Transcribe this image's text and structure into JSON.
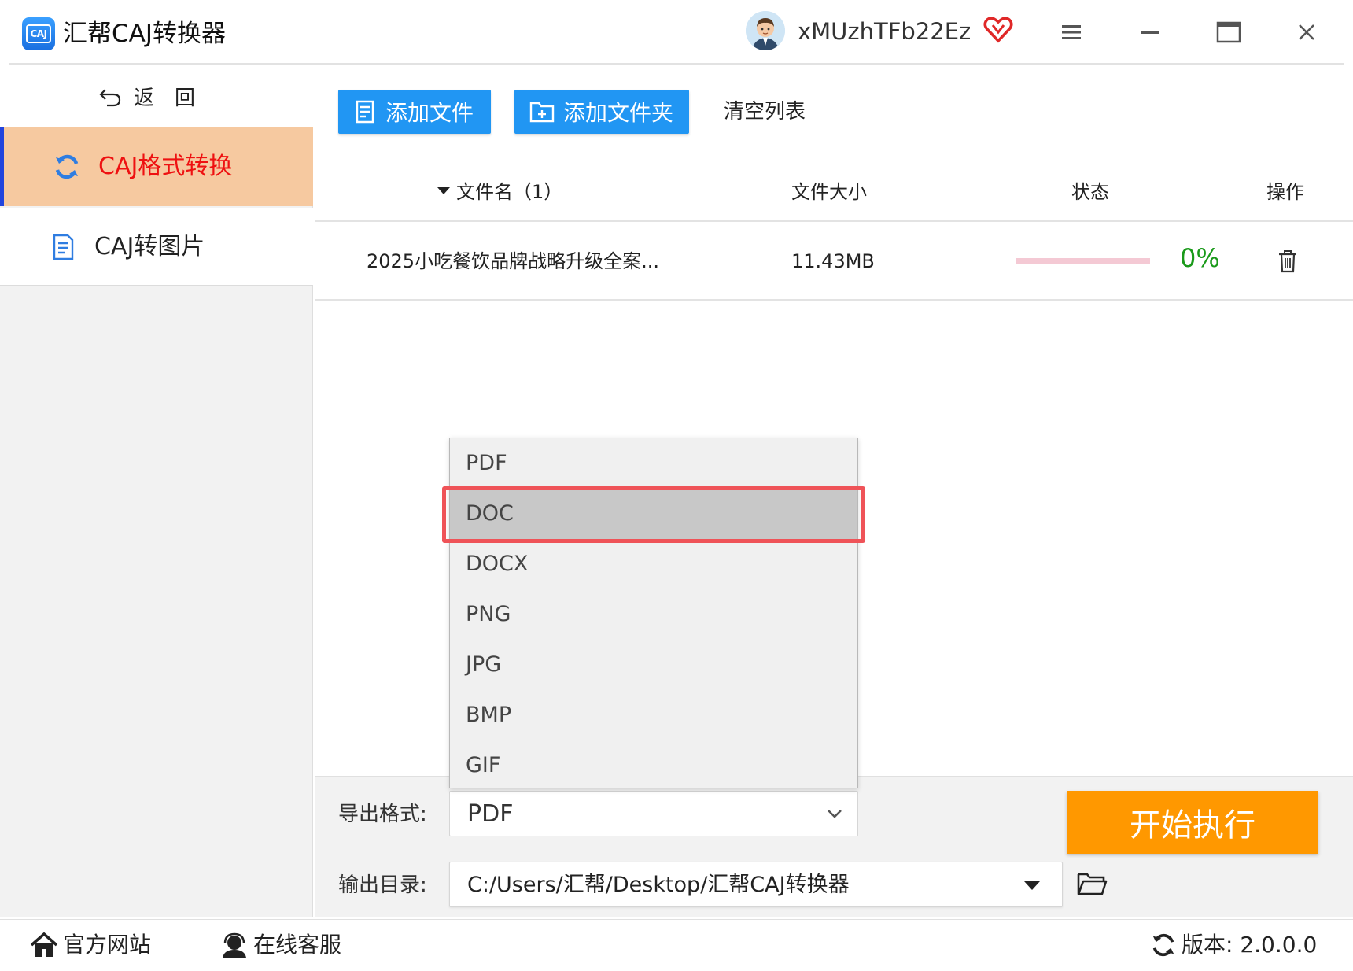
{
  "window": {
    "app_title": "汇帮CAJ转换器",
    "logo_text": "CAJ",
    "username": "xMUzhTFb22Ez"
  },
  "sidebar": {
    "back_label": "返回",
    "items": [
      {
        "label": "CAJ格式转换",
        "icon": "refresh-icon",
        "active": true
      },
      {
        "label": "CAJ转图片",
        "icon": "document-icon",
        "active": false
      }
    ]
  },
  "toolbar": {
    "add_file_label": "添加文件",
    "add_folder_label": "添加文件夹",
    "clear_list_label": "清空列表"
  },
  "table": {
    "columns": {
      "name": "文件名（1）",
      "size": "文件大小",
      "status": "状态",
      "ops": "操作"
    },
    "rows": [
      {
        "name": "2025小吃餐饮品牌战略升级全案...",
        "size": "11.43MB",
        "progress_percent": 0,
        "progress_label": "0%"
      }
    ]
  },
  "dropdown": {
    "options": [
      "PDF",
      "DOC",
      "DOCX",
      "PNG",
      "JPG",
      "BMP",
      "GIF"
    ],
    "highlighted": "DOC"
  },
  "export": {
    "format_label": "导出格式:",
    "format_value": "PDF",
    "dir_label": "输出目录:",
    "dir_value": "C:/Users/汇帮/Desktop/汇帮CAJ转换器",
    "start_label": "开始执行"
  },
  "footer": {
    "website_label": "官方网站",
    "service_label": "在线客服",
    "version_label": "版本: 2.0.0.0"
  },
  "colors": {
    "accent_blue": "#2196f3",
    "active_nav_bg": "#f6c9a0",
    "active_nav_text": "#ee1111",
    "start_button": "#ff9800",
    "progress_track": "#f4c9d4",
    "progress_text": "#1a9a1a",
    "highlight_border": "#ef5358"
  }
}
